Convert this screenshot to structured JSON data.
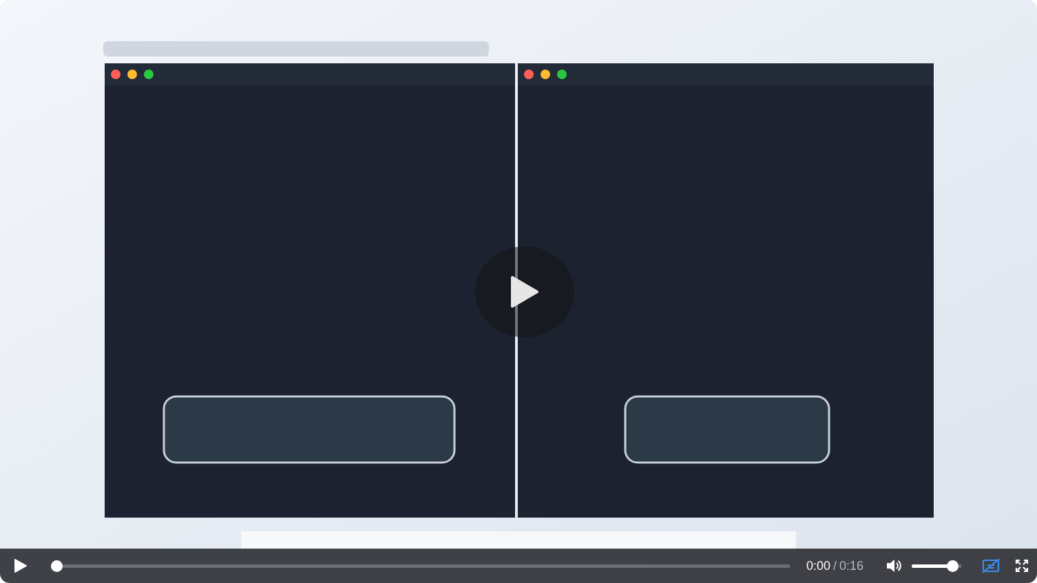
{
  "controls": {
    "progress": {
      "level": 0
    },
    "time": {
      "current": "0:00",
      "separator": "/",
      "duration": "0:16"
    },
    "volume": {
      "level": 0.92
    }
  }
}
